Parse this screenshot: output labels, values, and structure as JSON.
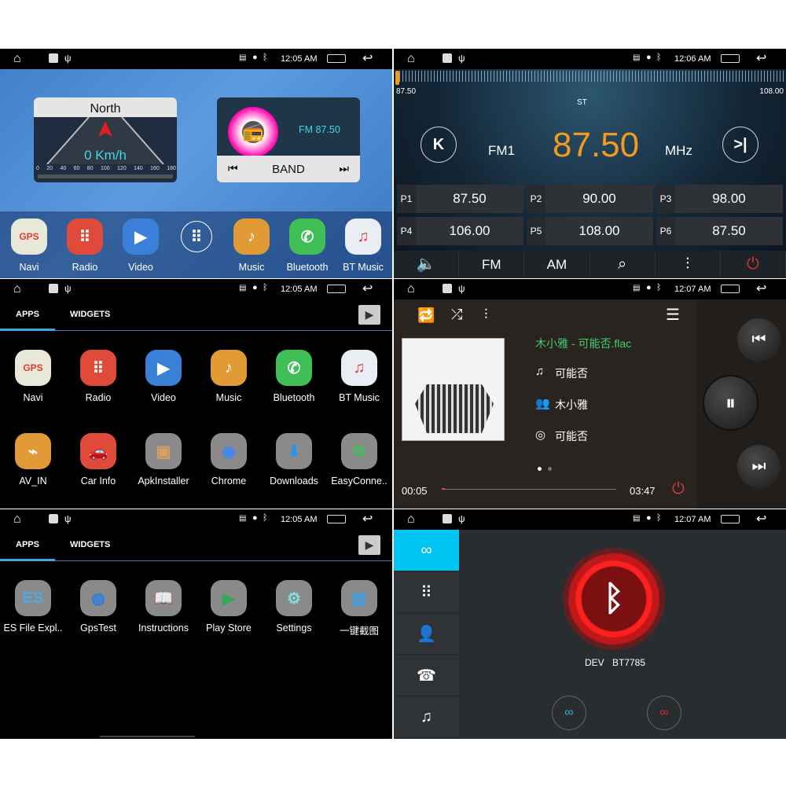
{
  "status_bars": [
    {
      "time": "12:05 AM"
    },
    {
      "time": "12:06 AM"
    },
    {
      "time": "12:05 AM"
    },
    {
      "time": "12:07 AM"
    },
    {
      "time": "12:05 AM"
    },
    {
      "time": "12:07 AM"
    }
  ],
  "home": {
    "nav_widget": {
      "heading": "North",
      "speed": "0 Km/h",
      "scale": [
        "0",
        "20",
        "40",
        "60",
        "80",
        "100",
        "120",
        "140",
        "160",
        "180"
      ]
    },
    "radio_widget": {
      "frequency": "FM 87.50",
      "band_label": "BAND"
    },
    "dock": [
      {
        "label": "Navi",
        "icon": "gps-pin-icon",
        "color": "#e8e8d8",
        "glyph": "GPS",
        "fg": "#e53935"
      },
      {
        "label": "Radio",
        "icon": "speaker-grid-icon",
        "color": "#e04a3a",
        "glyph": "⠿",
        "fg": "#fff"
      },
      {
        "label": "Video",
        "icon": "film-play-icon",
        "color": "#3a7fd8",
        "glyph": "▶",
        "fg": "#fff"
      },
      {
        "label": "",
        "icon": "app-drawer-icon",
        "color": "transparent",
        "glyph": "⠿",
        "fg": "#fff"
      },
      {
        "label": "Music",
        "icon": "music-note-icon",
        "color": "#e29a36",
        "glyph": "♪",
        "fg": "#fff"
      },
      {
        "label": "Bluetooth",
        "icon": "phone-bluetooth-icon",
        "color": "#3fbf55",
        "glyph": "✆",
        "fg": "#fff"
      },
      {
        "label": "BT Music",
        "icon": "bt-music-icon",
        "color": "#e8eef4",
        "glyph": "♫",
        "fg": "#e53935"
      }
    ]
  },
  "radio": {
    "scale_min": "87.50",
    "scale_max": "108.00",
    "stereo": "ST",
    "band": "FM1",
    "frequency": "87.50",
    "unit": "MHz",
    "accent": "#f29a1f",
    "presets": [
      {
        "id": "P1",
        "freq": "87.50"
      },
      {
        "id": "P2",
        "freq": "90.00"
      },
      {
        "id": "P3",
        "freq": "98.00"
      },
      {
        "id": "P4",
        "freq": "106.00"
      },
      {
        "id": "P5",
        "freq": "108.00"
      },
      {
        "id": "P6",
        "freq": "87.50"
      }
    ],
    "toolbar": [
      {
        "label": "",
        "icon": "mute-icon"
      },
      {
        "label": "FM",
        "icon": ""
      },
      {
        "label": "AM",
        "icon": ""
      },
      {
        "label": "",
        "icon": "search-icon"
      },
      {
        "label": "",
        "icon": "equalizer-icon"
      },
      {
        "label": "",
        "icon": "power-icon"
      }
    ]
  },
  "apps_page1": {
    "tabs": [
      "APPS",
      "WIDGETS"
    ],
    "apps": [
      {
        "label": "Navi",
        "icon": "gps-pin-icon",
        "color": "#e8e8d8",
        "glyph": "GPS",
        "fg": "#e53935"
      },
      {
        "label": "Radio",
        "icon": "speaker-grid-icon",
        "color": "#e04a3a",
        "glyph": "⠿",
        "fg": "#fff"
      },
      {
        "label": "Video",
        "icon": "film-play-icon",
        "color": "#3a7fd8",
        "glyph": "▶",
        "fg": "#fff"
      },
      {
        "label": "Music",
        "icon": "music-note-icon",
        "color": "#e29a36",
        "glyph": "♪",
        "fg": "#fff"
      },
      {
        "label": "Bluetooth",
        "icon": "phone-bluetooth-icon",
        "color": "#3fbf55",
        "glyph": "✆",
        "fg": "#fff"
      },
      {
        "label": "BT Music",
        "icon": "bt-music-icon",
        "color": "#e8eef4",
        "glyph": "♫",
        "fg": "#e53935"
      },
      {
        "label": "AV_IN",
        "icon": "av-cable-icon",
        "color": "#e29a36",
        "glyph": "⌁",
        "fg": "#fff"
      },
      {
        "label": "Car Info",
        "icon": "car-warning-icon",
        "color": "#e04a3a",
        "glyph": "🚗",
        "fg": "#fff"
      },
      {
        "label": "ApkInstaller",
        "icon": "package-box-icon",
        "color": "#8a8a8a",
        "glyph": "▣",
        "fg": "#d9a066"
      },
      {
        "label": "Chrome",
        "icon": "chrome-icon",
        "color": "#8a8a8a",
        "glyph": "◉",
        "fg": "#4285f4"
      },
      {
        "label": "Downloads",
        "icon": "download-icon",
        "color": "#8a8a8a",
        "glyph": "⬇",
        "fg": "#2196f3"
      },
      {
        "label": "EasyConne..",
        "icon": "easy-connect-icon",
        "color": "#8a8a8a",
        "glyph": "⧉",
        "fg": "#3fbf55"
      }
    ]
  },
  "apps_page2": {
    "tabs": [
      "APPS",
      "WIDGETS"
    ],
    "apps": [
      {
        "label": "ES File Expl..",
        "icon": "es-file-folder-icon",
        "color": "#8a8a8a",
        "glyph": "ES",
        "fg": "#4fa8e8"
      },
      {
        "label": "GpsTest",
        "icon": "radar-globe-icon",
        "color": "#8a8a8a",
        "glyph": "◍",
        "fg": "#2a7de1"
      },
      {
        "label": "Instructions",
        "icon": "open-book-icon",
        "color": "#8a8a8a",
        "glyph": "📖",
        "fg": "#fff"
      },
      {
        "label": "Play Store",
        "icon": "play-store-icon",
        "color": "#8a8a8a",
        "glyph": "▶",
        "fg": "#34a853"
      },
      {
        "label": "Settings",
        "icon": "gear-icon",
        "color": "#8a8a8a",
        "glyph": "⚙",
        "fg": "#7fe0e0"
      },
      {
        "label": "一键截图",
        "icon": "screenshot-image-icon",
        "color": "#8a8a8a",
        "glyph": "▨",
        "fg": "#3aa0e8"
      }
    ]
  },
  "music": {
    "title": "木小雅 - 可能否.flac",
    "song": "可能否",
    "artist": "木小雅",
    "album": "可能否",
    "elapsed": "00:05",
    "duration": "03:47",
    "progress_percent": 2,
    "title_color": "#3ecf6e",
    "page_dots": 2,
    "active_page": 1
  },
  "bluetooth": {
    "device_label": "DEV",
    "device_name": "BT7785",
    "sidebar": [
      "link-icon",
      "dialpad-icon",
      "contacts-icon",
      "call-log-icon",
      "music-icon"
    ],
    "active_tab": 0,
    "accent": "#00c4f2"
  }
}
